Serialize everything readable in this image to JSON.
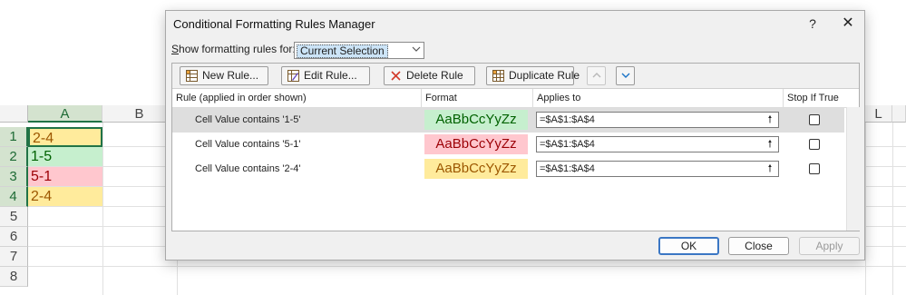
{
  "sheet": {
    "columns": [
      "A",
      "B",
      "L"
    ],
    "rows": [
      "1",
      "2",
      "3",
      "4",
      "5",
      "6",
      "7",
      "8"
    ],
    "cells": [
      {
        "value": "2-4",
        "bg": "#ffeb9c",
        "color": "#9c5700"
      },
      {
        "value": "1-5",
        "bg": "#c6efce",
        "color": "#006100"
      },
      {
        "value": "5-1",
        "bg": "#ffc7ce",
        "color": "#9c0006"
      },
      {
        "value": "2-4",
        "bg": "#ffeb9c",
        "color": "#9c5700"
      }
    ]
  },
  "dialog": {
    "title": "Conditional Formatting Rules Manager",
    "help_label": "?",
    "close_icon": "close-icon",
    "show_label_pre": "S",
    "show_label_rest": "how formatting rules for:",
    "show_value": "Current Selection",
    "toolbar": {
      "new_rule": "New Rule...",
      "edit_rule": "Edit Rule...",
      "delete_rule": "Delete Rule",
      "duplicate_rule": "Duplicate Rule",
      "move_up_icon": "chevron-up-icon",
      "move_down_icon": "chevron-down-icon"
    },
    "columns": {
      "rule": "Rule (applied in order shown)",
      "format": "Format",
      "applies_to": "Applies to",
      "stop_if_true": "Stop If True"
    },
    "rules": [
      {
        "rule": "Cell Value contains '1-5'",
        "format": "AaBbCcYyZz",
        "applies_to": "=$A$1:$A$4",
        "stop": false,
        "fmt_bg": "#c6efce",
        "fmt_color": "#006100"
      },
      {
        "rule": "Cell Value contains '5-1'",
        "format": "AaBbCcYyZz",
        "applies_to": "=$A$1:$A$4",
        "stop": false,
        "fmt_bg": "#ffc7ce",
        "fmt_color": "#9c0006"
      },
      {
        "rule": "Cell Value contains '2-4'",
        "format": "AaBbCcYyZz",
        "applies_to": "=$A$1:$A$4",
        "stop": false,
        "fmt_bg": "#ffeb9c",
        "fmt_color": "#9c5700"
      }
    ],
    "buttons": {
      "ok": "OK",
      "close": "Close",
      "apply": "Apply"
    }
  }
}
